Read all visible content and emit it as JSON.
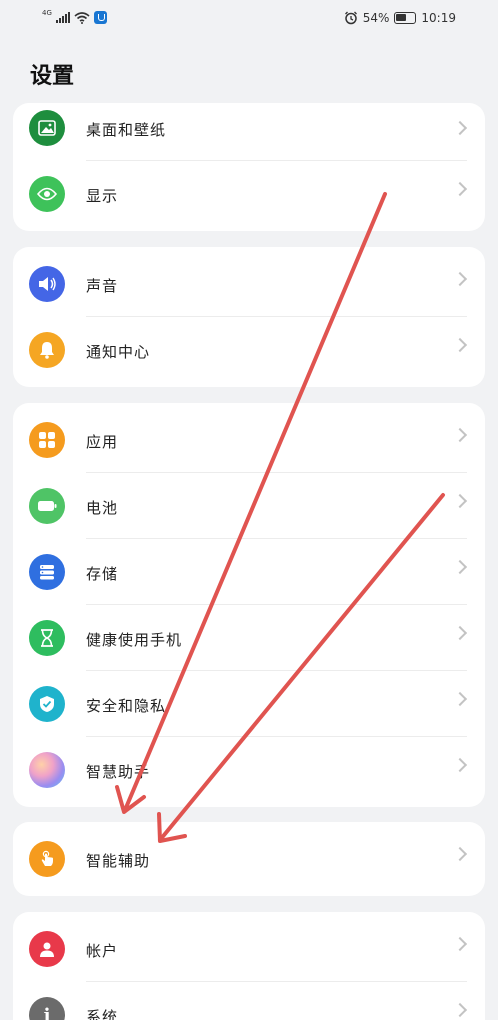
{
  "status_bar": {
    "signal_tag": "4G",
    "battery": "54%",
    "time": "10:19",
    "icons": [
      "signal-icon",
      "wifi-icon",
      "security-shield-icon",
      "alarm-icon",
      "battery-icon"
    ]
  },
  "page": {
    "title": "设置"
  },
  "groups": [
    {
      "items": [
        {
          "label": "桌面和壁纸",
          "icon": "wallpaper-icon",
          "color": "#1e8e3e"
        },
        {
          "label": "显示",
          "icon": "eye-icon",
          "color": "#3ec25a"
        }
      ]
    },
    {
      "items": [
        {
          "label": "声音",
          "icon": "speaker-icon",
          "color": "#4466e6"
        },
        {
          "label": "通知中心",
          "icon": "bell-icon",
          "color": "#f5a623"
        }
      ]
    },
    {
      "items": [
        {
          "label": "应用",
          "icon": "apps-grid-icon",
          "color": "#f59b1e"
        },
        {
          "label": "电池",
          "icon": "battery-icon",
          "color": "#4fc466"
        },
        {
          "label": "存储",
          "icon": "storage-icon",
          "color": "#2f6fe0"
        },
        {
          "label": "健康使用手机",
          "icon": "hourglass-icon",
          "color": "#2ebd5f"
        },
        {
          "label": "安全和隐私",
          "icon": "shield-check-icon",
          "color": "#1fb3cc"
        },
        {
          "label": "智慧助手",
          "icon": "assistant-orb-icon",
          "color": "#b78cf0"
        }
      ]
    },
    {
      "items": [
        {
          "label": "智能辅助",
          "icon": "touch-hand-icon",
          "color": "#f59b1e"
        }
      ]
    },
    {
      "items": [
        {
          "label": "帐户",
          "icon": "account-icon",
          "color": "#e8394a"
        },
        {
          "label": "系统",
          "icon": "info-icon",
          "color": "#6b6b6b"
        }
      ]
    }
  ],
  "annotations": {
    "arrow_color": "#e05450"
  }
}
